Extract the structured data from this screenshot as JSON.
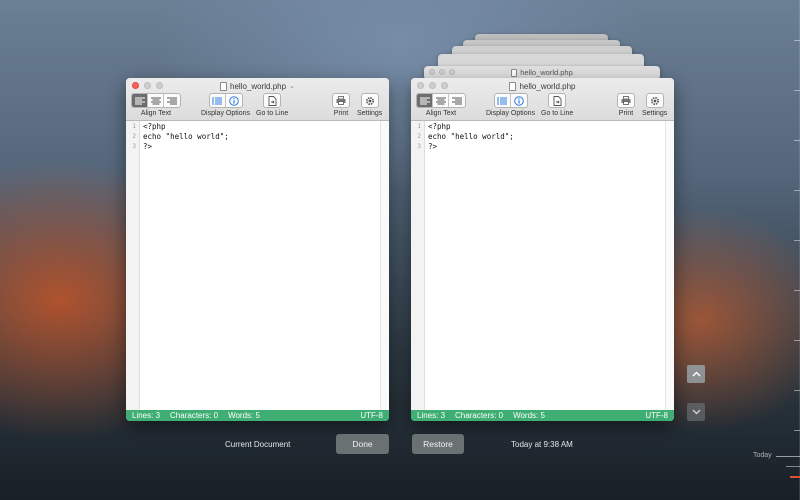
{
  "current_window": {
    "title": "hello_world.php",
    "toolbar": {
      "align_text_label": "Align Text",
      "display_options_label": "Display Options",
      "go_to_line_label": "Go to Line",
      "print_label": "Print",
      "settings_label": "Settings"
    },
    "line_numbers": [
      "1",
      "2",
      "3"
    ],
    "code_lines": [
      "<?php",
      "echo \"hello world\";",
      "?>"
    ],
    "status": {
      "lines": "Lines: 3",
      "characters": "Characters: 0",
      "words": "Words: 5",
      "encoding": "UTF-8"
    }
  },
  "version_window": {
    "title": "hello_world.php",
    "stack_title": "hello_world.php",
    "toolbar": {
      "align_text_label": "Align Text",
      "display_options_label": "Display Options",
      "go_to_line_label": "Go to Line",
      "print_label": "Print",
      "settings_label": "Settings"
    },
    "line_numbers": [
      "1",
      "2",
      "3"
    ],
    "code_lines": [
      "<?php",
      "echo \"hello world\";",
      "?>"
    ],
    "status": {
      "lines": "Lines: 3",
      "characters": "Characters: 0",
      "words": "Words: 5",
      "encoding": "UTF-8"
    }
  },
  "bottom": {
    "current_document_label": "Current Document",
    "done_label": "Done",
    "restore_label": "Restore",
    "version_timestamp": "Today at 9:38 AM"
  },
  "timeline": {
    "today_label": "Today"
  },
  "colors": {
    "status_bar": "#3fae73",
    "close_button": "#fc5f57",
    "timeline_marker": "#e0502e"
  }
}
